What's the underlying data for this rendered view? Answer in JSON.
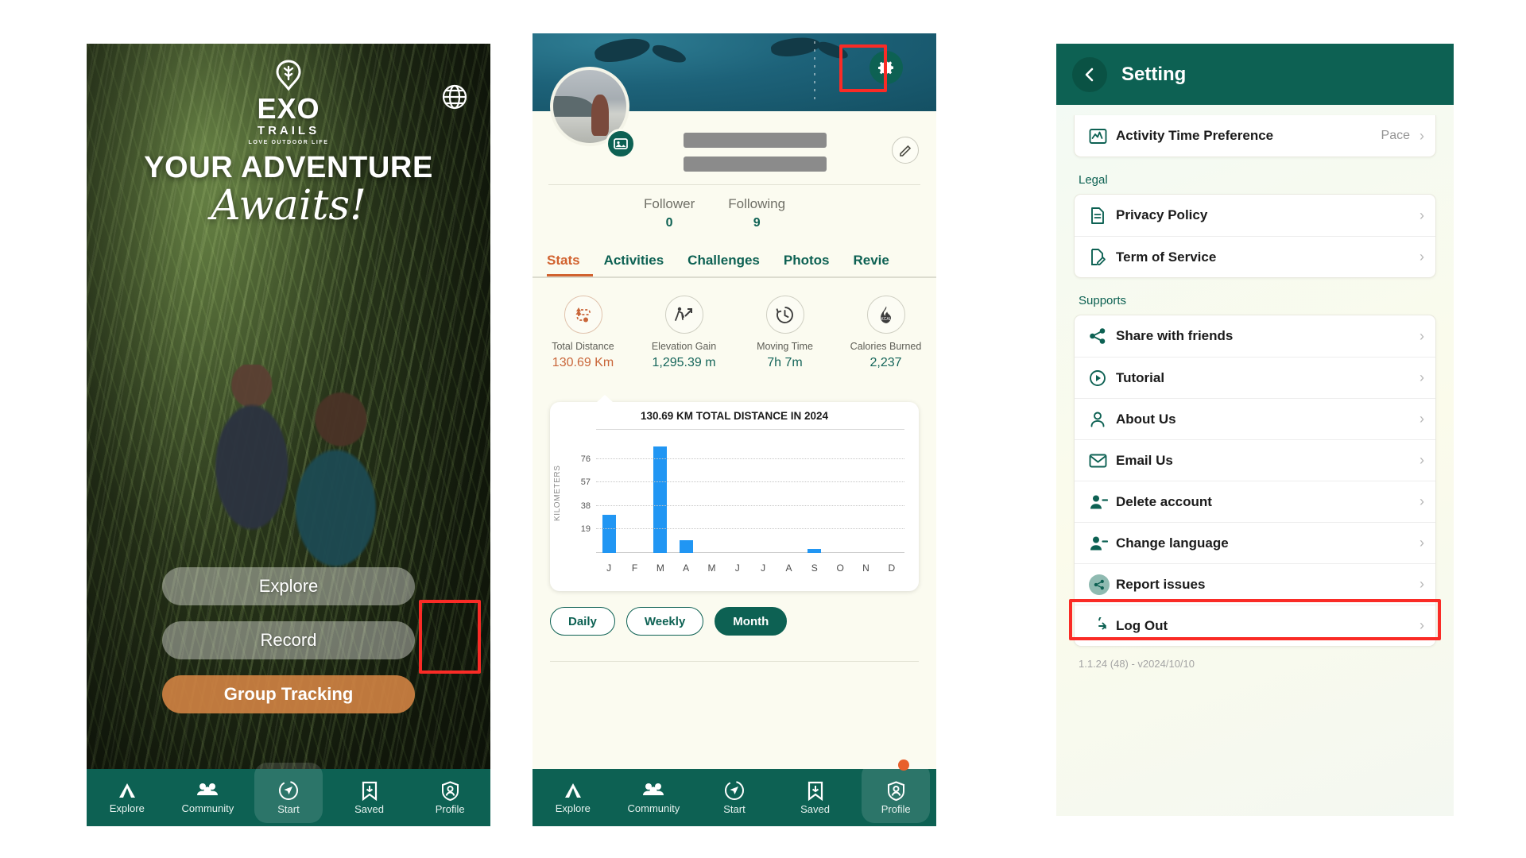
{
  "phone1": {
    "name": "welcome-screen",
    "logo": {
      "brand": "EXO",
      "sub": "TRAILS",
      "tagline": "LOVE OUTDOOR LIFE"
    },
    "headline_line1": "YOUR ADVENTURE",
    "headline_line2": "Awaits!",
    "buttons": [
      {
        "label": "Explore",
        "style": "ghost"
      },
      {
        "label": "Record",
        "style": "ghost"
      },
      {
        "label": "Group Tracking",
        "style": "primary"
      }
    ],
    "globe_icon": "globe-icon",
    "bottom_nav": {
      "items": [
        {
          "label": "Explore",
          "icon": "tent-icon",
          "active": false
        },
        {
          "label": "Community",
          "icon": "people-icon",
          "active": false
        },
        {
          "label": "Start",
          "icon": "compass-icon",
          "active": true
        },
        {
          "label": "Saved",
          "icon": "bookmark-icon",
          "active": false
        },
        {
          "label": "Profile",
          "icon": "shield-person-icon",
          "active": false
        }
      ]
    },
    "highlight": {
      "target": "Profile",
      "color": "#fa2b26"
    }
  },
  "phone2": {
    "name": "profile-stats-screen",
    "gear_icon": "gear-icon",
    "gear_highlight_color": "#fa2b26",
    "avatar_badge_icon": "photo-icon",
    "edit_icon": "pencil-icon",
    "follow": [
      {
        "label": "Follower",
        "value": "0"
      },
      {
        "label": "Following",
        "value": "9"
      }
    ],
    "tabs": [
      {
        "label": "Stats",
        "active": true
      },
      {
        "label": "Activities",
        "active": false
      },
      {
        "label": "Challenges",
        "active": false
      },
      {
        "label": "Photos",
        "active": false
      },
      {
        "label": "Revie",
        "active": false
      }
    ],
    "metrics": [
      {
        "label": "Total Distance",
        "value": "130.69 Km",
        "icon": "route-tree-icon"
      },
      {
        "label": "Elevation Gain",
        "value": "1,295.39 m",
        "icon": "hiker-uphill-icon"
      },
      {
        "label": "Moving Time",
        "value": "7h 7m",
        "icon": "clock-icon"
      },
      {
        "label": "Calories Burned",
        "value": "2,237",
        "icon": "flame-kcal-icon"
      }
    ],
    "period_buttons": [
      {
        "label": "Daily",
        "active": false
      },
      {
        "label": "Weekly",
        "active": false
      },
      {
        "label": "Month",
        "active": true
      }
    ],
    "bottom_nav": {
      "items": [
        {
          "label": "Explore",
          "icon": "tent-icon",
          "active": false
        },
        {
          "label": "Community",
          "icon": "people-icon",
          "active": false
        },
        {
          "label": "Start",
          "icon": "compass-icon",
          "active": false
        },
        {
          "label": "Saved",
          "icon": "bookmark-icon",
          "active": false
        },
        {
          "label": "Profile",
          "icon": "shield-person-icon",
          "active": true
        }
      ],
      "notification_dot": true
    }
  },
  "chart_data": {
    "type": "bar",
    "title": "130.69 KM TOTAL DISTANCE IN 2024",
    "xlabel": "",
    "ylabel": "KILOMETERS",
    "categories": [
      "J",
      "F",
      "M",
      "A",
      "M",
      "J",
      "J",
      "A",
      "S",
      "O",
      "N",
      "D"
    ],
    "values": [
      31,
      0,
      86,
      10,
      0,
      0,
      0,
      0,
      3,
      0,
      0,
      0
    ],
    "yticks": [
      19,
      38,
      57,
      76
    ],
    "ylim": [
      0,
      95
    ],
    "grid": true,
    "legend": "none",
    "series_color": "#2196f3"
  },
  "phone3": {
    "name": "settings-screen",
    "title": "Setting",
    "back_icon": "chevron-left-icon",
    "top_partial": {
      "label": "Activity Time Preference",
      "value": "Pace",
      "icon": "activity-chart-icon"
    },
    "sections": [
      {
        "title": "Legal",
        "items": [
          {
            "label": "Privacy Policy",
            "icon": "document-lines-icon"
          },
          {
            "label": "Term of Service",
            "icon": "document-pencil-icon"
          }
        ]
      },
      {
        "title": "Supports",
        "items": [
          {
            "label": "Share with friends",
            "icon": "share-icon"
          },
          {
            "label": "Tutorial",
            "icon": "play-circle-icon"
          },
          {
            "label": "About Us",
            "icon": "person-icon"
          },
          {
            "label": "Email Us",
            "icon": "envelope-icon"
          },
          {
            "label": "Delete account",
            "icon": "person-minus-icon"
          },
          {
            "label": "Change language",
            "icon": "person-minus-icon"
          },
          {
            "label": "Report issues",
            "icon": "share-circle-icon",
            "highlighted": true
          },
          {
            "label": "Log Out",
            "icon": "logout-icon"
          }
        ]
      }
    ],
    "version": "1.1.24 (48) - v2024/10/10",
    "highlight": {
      "target": "Report issues",
      "color": "#fa2b26"
    }
  }
}
